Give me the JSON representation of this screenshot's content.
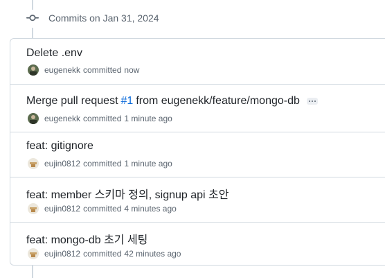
{
  "group": {
    "title": "Commits on Jan 31, 2024"
  },
  "commits": [
    {
      "title": "Delete .env",
      "author": "eugenekk",
      "verb": "committed",
      "time": "now",
      "avatar": "eugenekk-avatar"
    },
    {
      "title_prefix": "Merge pull request",
      "pr": "#1",
      "title_suffix": "from eugenekk/feature/mongo-db",
      "author": "eugenekk",
      "verb": "committed",
      "time": "1 minute ago",
      "avatar": "eugenekk-avatar"
    },
    {
      "title": "feat: gitignore",
      "author": "eujin0812",
      "verb": "committed",
      "time": "1 minute ago",
      "avatar": "eujin0812-avatar"
    },
    {
      "title": "feat: member 스키마 정의, signup api 초안",
      "author": "eujin0812",
      "verb": "committed",
      "time": "4 minutes ago",
      "avatar": "eujin0812-avatar"
    },
    {
      "title": "feat: mongo-db 초기 세팅",
      "author": "eujin0812",
      "verb": "committed",
      "time": "42 minutes ago",
      "avatar": "eujin0812-avatar"
    }
  ],
  "colors": {
    "link": "#0969da",
    "border": "#d1d9e0",
    "muted": "#59636e",
    "text": "#1f2328"
  }
}
